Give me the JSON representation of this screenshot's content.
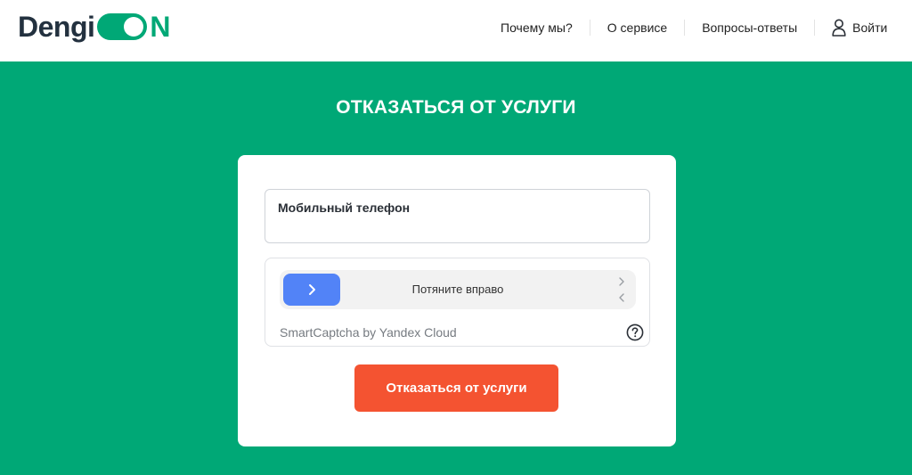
{
  "header": {
    "logo": {
      "text": "Dengi",
      "suffix": "N"
    },
    "nav": [
      {
        "label": "Почему мы?"
      },
      {
        "label": "О сервисе"
      },
      {
        "label": "Вопросы-ответы"
      }
    ],
    "login_label": "Войти"
  },
  "main": {
    "title": "ОТКАЗАТЬСЯ ОТ УСЛУГИ",
    "form": {
      "phone": {
        "label": "Мобильный телефон",
        "value": ""
      },
      "captcha": {
        "slider_label": "Потяните вправо",
        "brand": "SmartCaptcha by Yandex Cloud"
      },
      "submit_label": "Отказаться от услуги"
    }
  },
  "colors": {
    "brand_green": "#00a876",
    "logo_dark": "#23313f",
    "button_orange": "#f45331",
    "slider_blue": "#5283f7",
    "white": "#ffffff"
  },
  "icons": [
    "user-icon",
    "chevron-right-icon",
    "chevron-right-icon-small",
    "chevron-left-icon-small",
    "help-icon"
  ]
}
